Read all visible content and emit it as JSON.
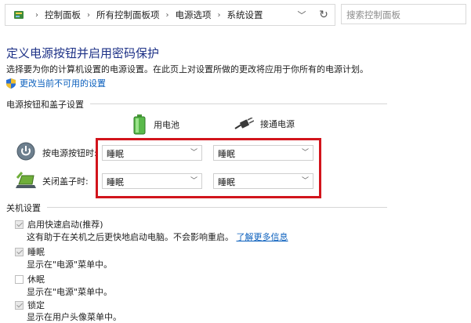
{
  "breadcrumb": [
    "控制面板",
    "所有控制面板项",
    "电源选项",
    "系统设置"
  ],
  "search": {
    "placeholder": "搜索控制面板"
  },
  "page": {
    "title": "定义电源按钮并启用密码保护",
    "description": "选择要为你的计算机设置的电源设置。在此页上对设置所做的更改将应用于你所有的电源计划。",
    "change_link": "更改当前不可用的设置"
  },
  "power_section": {
    "label": "电源按钮和盖子设置",
    "battery_label": "用电池",
    "plugged_label": "接通电源",
    "rows": [
      {
        "label": "按电源按钮时:",
        "battery": "睡眠",
        "plugged": "睡眠"
      },
      {
        "label": "关闭盖子时:",
        "battery": "睡眠",
        "plugged": "睡眠"
      }
    ]
  },
  "shutdown_section": {
    "label": "关机设置",
    "items": [
      {
        "label": "启用快速启动(推荐)",
        "checked": true,
        "desc": "这有助于在关机之后更快地启动电脑。不会影响重启。",
        "link": "了解更多信息"
      },
      {
        "label": "睡眠",
        "checked": true,
        "desc": "显示在\"电源\"菜单中。"
      },
      {
        "label": "休眠",
        "checked": false,
        "desc": "显示在\"电源\"菜单中。"
      },
      {
        "label": "锁定",
        "checked": true,
        "desc": "显示在用户头像菜单中。"
      }
    ]
  },
  "colors": {
    "title": "#1e3287",
    "link": "#0a5fbd",
    "highlight": "#d2141c"
  }
}
